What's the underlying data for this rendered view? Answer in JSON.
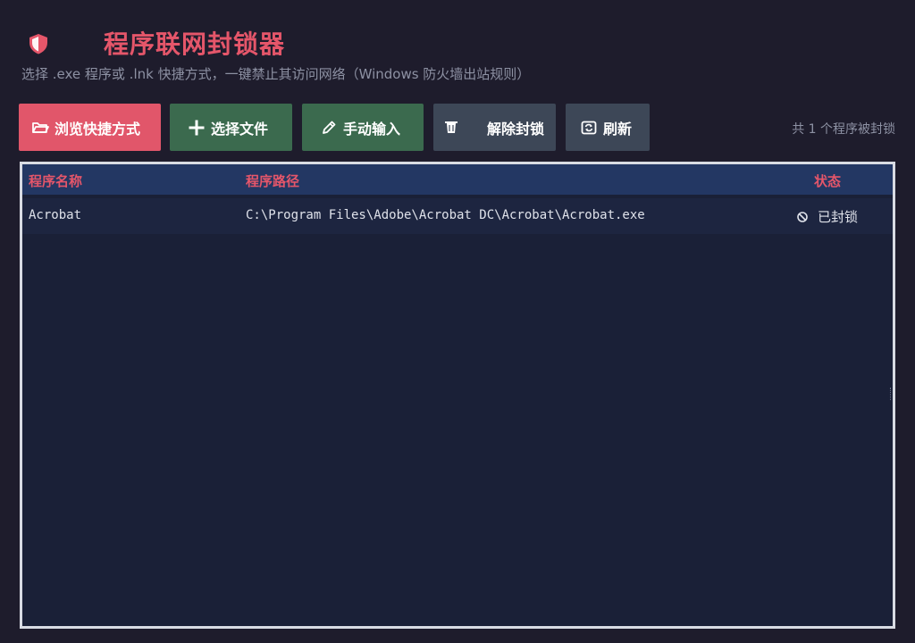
{
  "header": {
    "logo_icon": "shield-icon",
    "title": "程序联网封锁器",
    "subtitle": "选择 .exe 程序或 .lnk 快捷方式，一键禁止其访问网络（Windows 防火墙出站规则）"
  },
  "toolbar": {
    "browse_label": "浏览快捷方式",
    "browse_icon": "folder-icon",
    "select_label": "选择文件",
    "select_icon": "plus-icon",
    "manual_label": "手动输入",
    "manual_icon": "pencil-icon",
    "unblock_label": "解除封锁",
    "unblock_icon": "trash-icon",
    "refresh_label": "刷新",
    "refresh_icon": "refresh-icon",
    "count_text": "共 1 个程序被封锁"
  },
  "colors": {
    "accent": "#e1566a",
    "green": "#3b6a4e",
    "gray": "#3d4757",
    "header_bg": "#233763"
  },
  "table": {
    "columns": [
      "程序名称",
      "程序路径",
      "状态"
    ],
    "rows": [
      {
        "name": "Acrobat",
        "path": "C:\\Program Files\\Adobe\\Acrobat DC\\Acrobat\\Acrobat.exe",
        "status": "已封锁",
        "status_icon": "blocked-icon"
      }
    ]
  }
}
